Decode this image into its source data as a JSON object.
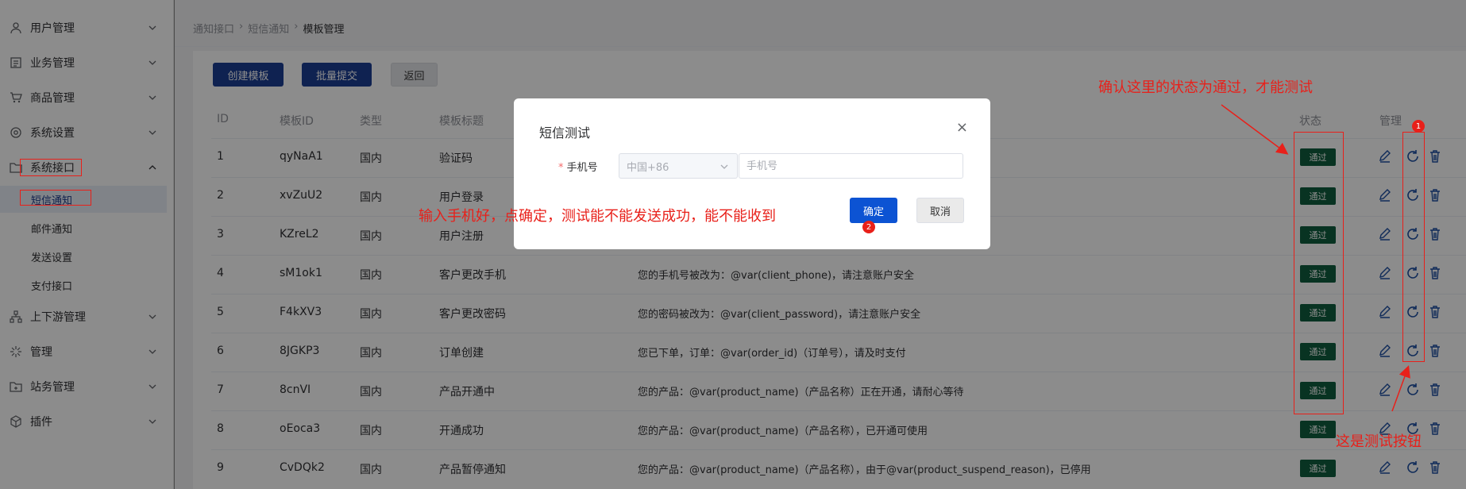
{
  "sidebar": {
    "items": [
      {
        "label": "用户管理"
      },
      {
        "label": "业务管理"
      },
      {
        "label": "商品管理"
      },
      {
        "label": "系统设置"
      },
      {
        "label": "系统接口"
      },
      {
        "label": "上下游管理"
      },
      {
        "label": "管理"
      },
      {
        "label": "站务管理"
      },
      {
        "label": "插件"
      }
    ],
    "subitems": [
      {
        "label": "短信通知"
      },
      {
        "label": "邮件通知"
      },
      {
        "label": "发送设置"
      },
      {
        "label": "支付接口"
      }
    ]
  },
  "breadcrumb": [
    "通知接口",
    "短信通知",
    "模板管理"
  ],
  "toolbar": {
    "create_label": "创建模板",
    "batch_label": "批量提交",
    "back_label": "返回"
  },
  "table": {
    "headers": [
      "ID",
      "模板ID",
      "类型",
      "模板标题",
      "状态",
      "管理"
    ],
    "rows": [
      {
        "id": "1",
        "tid": "qyNaA1",
        "type": "国内",
        "title": "验证码",
        "content": "",
        "status": "通过"
      },
      {
        "id": "2",
        "tid": "xvZuU2",
        "type": "国内",
        "title": "用户登录",
        "content": "",
        "status": "通过"
      },
      {
        "id": "3",
        "tid": "KZreL2",
        "type": "国内",
        "title": "用户注册",
        "content": "",
        "status": "通过"
      },
      {
        "id": "4",
        "tid": "sM1ok1",
        "type": "国内",
        "title": "客户更改手机",
        "content": "您的手机号被改为：@var(client_phone)，请注意账户安全",
        "status": "通过"
      },
      {
        "id": "5",
        "tid": "F4kXV3",
        "type": "国内",
        "title": "客户更改密码",
        "content": "您的密码被改为：@var(client_password)，请注意账户安全",
        "status": "通过"
      },
      {
        "id": "6",
        "tid": "8JGKP3",
        "type": "国内",
        "title": "订单创建",
        "content": "您已下单，订单：@var(order_id)（订单号），请及时支付",
        "status": "通过"
      },
      {
        "id": "7",
        "tid": "8cnVI",
        "type": "国内",
        "title": "产品开通中",
        "content": "您的产品：@var(product_name)（产品名称）正在开通，请耐心等待",
        "status": "通过"
      },
      {
        "id": "8",
        "tid": "oEoca3",
        "type": "国内",
        "title": "开通成功",
        "content": "您的产品：@var(product_name)（产品名称），已开通可使用",
        "status": "通过"
      },
      {
        "id": "9",
        "tid": "CvDQk2",
        "type": "国内",
        "title": "产品暂停通知",
        "content": "您的产品：@var(product_name)（产品名称），由于@var(product_suspend_reason)，已停用",
        "status": "通过"
      }
    ]
  },
  "modal": {
    "title": "短信测试",
    "close_glyph": "×",
    "required_mark": "*",
    "phone_label": "手机号",
    "country_value": "中国+86",
    "phone_placeholder": "手机号",
    "confirm_label": "确定",
    "cancel_label": "取消"
  },
  "annotations": {
    "status_note": "确认这里的状态为通过，才能测试",
    "input_note": "输入手机好，点确定，测试能不能发送成功，能不能收到",
    "button_note": "这是测试按钮",
    "marker_1": "1",
    "marker_2": "2"
  },
  "colors": {
    "primary": "#1c3f94",
    "status_badge": "#0f5e3e",
    "annotation_red": "#e8201a",
    "action_icon": "#1e4fa3"
  }
}
